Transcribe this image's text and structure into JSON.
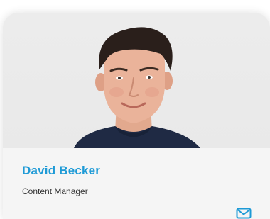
{
  "profile": {
    "name": "David Becker",
    "role": "Content Manager",
    "photo_icon": "person-photo",
    "contact_icon": "mail-icon"
  },
  "colors": {
    "accent": "#1d9ad6",
    "card_bg": "#f5f5f5",
    "photo_bg": "#ebebeb"
  }
}
